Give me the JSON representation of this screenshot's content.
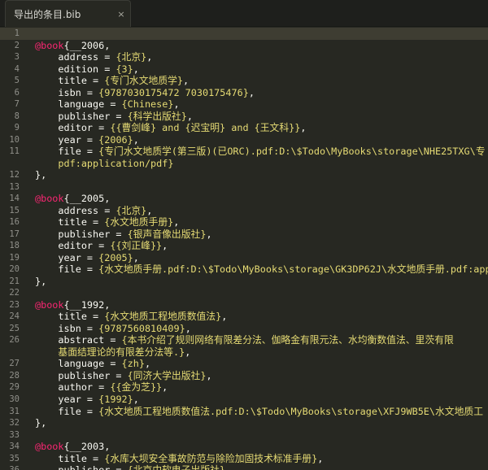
{
  "tab": {
    "title": "导出的条目.bib",
    "close": "×"
  },
  "lines": [
    {
      "n": "1",
      "active": true,
      "parts": []
    },
    {
      "n": "2",
      "parts": [
        [
          "at",
          "@book"
        ],
        [
          "punct",
          "{"
        ],
        [
          "plain",
          "__2006,"
        ]
      ]
    },
    {
      "n": "3",
      "parts": [
        [
          "plain",
          "    address = "
        ],
        [
          "str",
          "{北京}"
        ],
        [
          "plain",
          ","
        ]
      ]
    },
    {
      "n": "4",
      "parts": [
        [
          "plain",
          "    edition = "
        ],
        [
          "str",
          "{3}"
        ],
        [
          "plain",
          ","
        ]
      ]
    },
    {
      "n": "5",
      "parts": [
        [
          "plain",
          "    title = "
        ],
        [
          "str",
          "{专门水文地质学}"
        ],
        [
          "plain",
          ","
        ]
      ]
    },
    {
      "n": "6",
      "parts": [
        [
          "plain",
          "    isbn = "
        ],
        [
          "str",
          "{9787030175472 7030175476}"
        ],
        [
          "plain",
          ","
        ]
      ]
    },
    {
      "n": "7",
      "parts": [
        [
          "plain",
          "    language = "
        ],
        [
          "str",
          "{Chinese}"
        ],
        [
          "plain",
          ","
        ]
      ]
    },
    {
      "n": "8",
      "parts": [
        [
          "plain",
          "    publisher = "
        ],
        [
          "str",
          "{科学出版社}"
        ],
        [
          "plain",
          ","
        ]
      ]
    },
    {
      "n": "9",
      "parts": [
        [
          "plain",
          "    editor = "
        ],
        [
          "str",
          "{{曹剑峰} and {迟宝明} and {王文科}}"
        ],
        [
          "plain",
          ","
        ]
      ]
    },
    {
      "n": "10",
      "parts": [
        [
          "plain",
          "    year = "
        ],
        [
          "str",
          "{2006}"
        ],
        [
          "plain",
          ","
        ]
      ]
    },
    {
      "n": "11",
      "parts": [
        [
          "plain",
          "    file = "
        ],
        [
          "str",
          "{专门水文地质学(第三版)(已ORC).pdf:D:\\$Todo\\MyBooks\\storage\\NHE25TXG\\专"
        ]
      ]
    },
    {
      "n": "",
      "parts": [
        [
          "str",
          "    pdf:application/pdf}"
        ]
      ]
    },
    {
      "n": "12",
      "parts": [
        [
          "plain",
          "},"
        ]
      ]
    },
    {
      "n": "13",
      "parts": []
    },
    {
      "n": "14",
      "parts": [
        [
          "at",
          "@book"
        ],
        [
          "punct",
          "{"
        ],
        [
          "plain",
          "__2005,"
        ]
      ]
    },
    {
      "n": "15",
      "parts": [
        [
          "plain",
          "    address = "
        ],
        [
          "str",
          "{北京}"
        ],
        [
          "plain",
          ","
        ]
      ]
    },
    {
      "n": "16",
      "parts": [
        [
          "plain",
          "    title = "
        ],
        [
          "str",
          "{水文地质手册}"
        ],
        [
          "plain",
          ","
        ]
      ]
    },
    {
      "n": "17",
      "parts": [
        [
          "plain",
          "    publisher = "
        ],
        [
          "str",
          "{银声音像出版社}"
        ],
        [
          "plain",
          ","
        ]
      ]
    },
    {
      "n": "18",
      "parts": [
        [
          "plain",
          "    editor = "
        ],
        [
          "str",
          "{{刘正峰}}"
        ],
        [
          "plain",
          ","
        ]
      ]
    },
    {
      "n": "19",
      "parts": [
        [
          "plain",
          "    year = "
        ],
        [
          "str",
          "{2005}"
        ],
        [
          "plain",
          ","
        ]
      ]
    },
    {
      "n": "20",
      "parts": [
        [
          "plain",
          "    file = "
        ],
        [
          "str",
          "{水文地质手册.pdf:D:\\$Todo\\MyBooks\\storage\\GK3DP62J\\水文地质手册.pdf:appl"
        ]
      ]
    },
    {
      "n": "21",
      "parts": [
        [
          "plain",
          "},"
        ]
      ]
    },
    {
      "n": "22",
      "parts": []
    },
    {
      "n": "23",
      "parts": [
        [
          "at",
          "@book"
        ],
        [
          "punct",
          "{"
        ],
        [
          "plain",
          "__1992,"
        ]
      ]
    },
    {
      "n": "24",
      "parts": [
        [
          "plain",
          "    title = "
        ],
        [
          "str",
          "{水文地质工程地质数值法}"
        ],
        [
          "plain",
          ","
        ]
      ]
    },
    {
      "n": "25",
      "parts": [
        [
          "plain",
          "    isbn = "
        ],
        [
          "str",
          "{9787560810409}"
        ],
        [
          "plain",
          ","
        ]
      ]
    },
    {
      "n": "26",
      "parts": [
        [
          "plain",
          "    abstract = "
        ],
        [
          "str",
          "{本书介绍了规则网络有限差分法、伽略金有限元法、水均衡数值法、里茨有限"
        ]
      ]
    },
    {
      "n": "",
      "parts": [
        [
          "str",
          "    基面结理论的有限差分法等.}"
        ],
        [
          "plain",
          ","
        ]
      ]
    },
    {
      "n": "27",
      "parts": [
        [
          "plain",
          "    language = "
        ],
        [
          "str",
          "{zh}"
        ],
        [
          "plain",
          ","
        ]
      ]
    },
    {
      "n": "28",
      "parts": [
        [
          "plain",
          "    publisher = "
        ],
        [
          "str",
          "{同济大学出版社}"
        ],
        [
          "plain",
          ","
        ]
      ]
    },
    {
      "n": "29",
      "parts": [
        [
          "plain",
          "    author = "
        ],
        [
          "str",
          "{{金为芝}}"
        ],
        [
          "plain",
          ","
        ]
      ]
    },
    {
      "n": "30",
      "parts": [
        [
          "plain",
          "    year = "
        ],
        [
          "str",
          "{1992}"
        ],
        [
          "plain",
          ","
        ]
      ]
    },
    {
      "n": "31",
      "parts": [
        [
          "plain",
          "    file = "
        ],
        [
          "str",
          "{水文地质工程地质数值法.pdf:D:\\$Todo\\MyBooks\\storage\\XFJ9WB5E\\水文地质工"
        ]
      ]
    },
    {
      "n": "32",
      "parts": [
        [
          "plain",
          "},"
        ]
      ]
    },
    {
      "n": "33",
      "parts": []
    },
    {
      "n": "34",
      "parts": [
        [
          "at",
          "@book"
        ],
        [
          "punct",
          "{"
        ],
        [
          "plain",
          "__2003,"
        ]
      ]
    },
    {
      "n": "35",
      "parts": [
        [
          "plain",
          "    title = "
        ],
        [
          "str",
          "{水库大坝安全事故防范与除险加固技术标准手册}"
        ],
        [
          "plain",
          ","
        ]
      ]
    },
    {
      "n": "36",
      "parts": [
        [
          "plain",
          "    publisher = "
        ],
        [
          "str",
          "{北京中软电子出版社}"
        ],
        [
          "plain",
          ","
        ]
      ]
    }
  ],
  "colors": {
    "background": "#272822",
    "keyword": "#f92672",
    "string": "#e6db74",
    "text": "#f8f8f2",
    "gutter": "#90908a"
  }
}
